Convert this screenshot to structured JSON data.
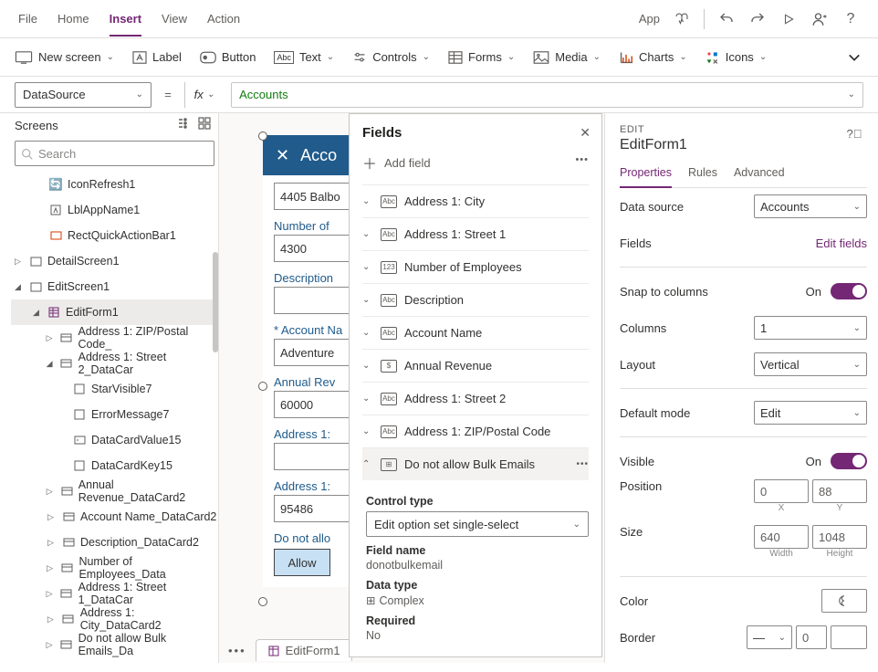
{
  "menu": {
    "file": "File",
    "home": "Home",
    "insert": "Insert",
    "view": "View",
    "action": "Action",
    "app": "App"
  },
  "toolbar": {
    "newscreen": "New screen",
    "label": "Label",
    "button": "Button",
    "text": "Text",
    "controls": "Controls",
    "forms": "Forms",
    "media": "Media",
    "charts": "Charts",
    "icons": "Icons"
  },
  "formula": {
    "property": "DataSource",
    "eq": "=",
    "fx": "fx",
    "value": "Accounts"
  },
  "screens": {
    "title": "Screens",
    "search_ph": "Search",
    "items": [
      {
        "i": "icon-refresh",
        "label": "IconRefresh1"
      },
      {
        "i": "label",
        "label": "LblAppName1"
      },
      {
        "i": "rect",
        "label": "RectQuickActionBar1"
      }
    ],
    "detail": "DetailScreen1",
    "edit": "EditScreen1",
    "form": "EditForm1",
    "cards": [
      "Address 1: ZIP/Postal Code_",
      "Address 1: Street 2_DataCar",
      "Annual Revenue_DataCard2",
      "Account Name_DataCard2",
      "Description_DataCard2",
      "Number of Employees_Data",
      "Address 1: Street 1_DataCar",
      "Address 1: City_DataCard2",
      "Do not allow Bulk Emails_Da"
    ],
    "street2_children": [
      "StarVisible7",
      "ErrorMessage7",
      "DataCardValue15",
      "DataCardKey15"
    ]
  },
  "canvas": {
    "title": "Acco",
    "f1": {
      "v": "4405 Balbo"
    },
    "f2": {
      "l": "Number of",
      "v": "4300"
    },
    "f3": {
      "l": "Description",
      "v": ""
    },
    "f4": {
      "l": "Account Na",
      "v": "Adventure",
      "req": "*"
    },
    "f5": {
      "l": "Annual Rev",
      "v": "60000"
    },
    "f6": {
      "l": "Address 1:",
      "v": ""
    },
    "f7": {
      "l": "Address 1:",
      "v": "95486"
    },
    "f8": {
      "l": "Do not allo",
      "v": "Allow"
    },
    "tab": "EditForm1"
  },
  "fields": {
    "title": "Fields",
    "add": "Add field",
    "rows": [
      {
        "t": "Abc",
        "l": "Address 1: City"
      },
      {
        "t": "Abc",
        "l": "Address 1: Street 1"
      },
      {
        "t": "123",
        "l": "Number of Employees"
      },
      {
        "t": "Abc",
        "l": "Description"
      },
      {
        "t": "Abc",
        "l": "Account Name"
      },
      {
        "t": "$",
        "l": "Annual Revenue"
      },
      {
        "t": "Abc",
        "l": "Address 1: Street 2"
      },
      {
        "t": "Abc",
        "l": "Address 1: ZIP/Postal Code"
      },
      {
        "t": "⊞",
        "l": "Do not allow Bulk Emails"
      }
    ],
    "detail": {
      "ctl_lbl": "Control type",
      "ctl_val": "Edit option set single-select",
      "fn_lbl": "Field name",
      "fn_val": "donotbulkemail",
      "dt_lbl": "Data type",
      "dt_val": "Complex",
      "rq_lbl": "Required",
      "rq_val": "No"
    }
  },
  "props": {
    "kicker": "EDIT",
    "title": "EditForm1",
    "tabs": {
      "p": "Properties",
      "r": "Rules",
      "a": "Advanced"
    },
    "datasource": {
      "l": "Data source",
      "v": "Accounts"
    },
    "fields": {
      "l": "Fields",
      "v": "Edit fields"
    },
    "snap": {
      "l": "Snap to columns",
      "v": "On"
    },
    "columns": {
      "l": "Columns",
      "v": "1"
    },
    "layout": {
      "l": "Layout",
      "v": "Vertical"
    },
    "mode": {
      "l": "Default mode",
      "v": "Edit"
    },
    "visible": {
      "l": "Visible",
      "v": "On"
    },
    "position": {
      "l": "Position",
      "x": "0",
      "y": "88",
      "xl": "X",
      "yl": "Y"
    },
    "size": {
      "l": "Size",
      "w": "640",
      "h": "1048",
      "wl": "Width",
      "hl": "Height"
    },
    "color": {
      "l": "Color"
    },
    "border": {
      "l": "Border",
      "v": "0"
    }
  }
}
